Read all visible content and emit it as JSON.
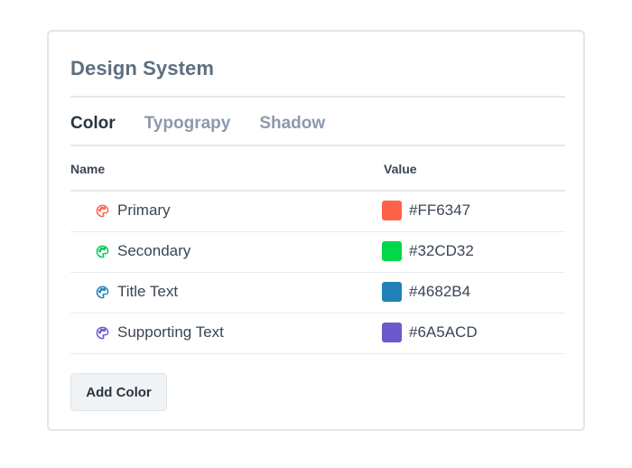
{
  "card": {
    "title": "Design System"
  },
  "tabs": [
    {
      "label": "Color",
      "active": true
    },
    {
      "label": "Typograpy",
      "active": false
    },
    {
      "label": "Shadow",
      "active": false
    }
  ],
  "table": {
    "columns": [
      "Name",
      "Value"
    ],
    "rows": [
      {
        "name": "Primary",
        "value": "#FF6347",
        "swatch_color": "#FF6347",
        "icon": "palette-icon"
      },
      {
        "name": "Secondary",
        "value": "#32CD32",
        "swatch_color": "#00D84A",
        "icon": "palette-icon"
      },
      {
        "name": "Title Text",
        "value": "#4682B4",
        "swatch_color": "#2281B8",
        "icon": "palette-icon"
      },
      {
        "name": "Supporting Text",
        "value": "#6A5ACD",
        "swatch_color": "#6A5ACD",
        "icon": "palette-icon"
      }
    ]
  },
  "actions": {
    "add_label": "Add Color"
  }
}
